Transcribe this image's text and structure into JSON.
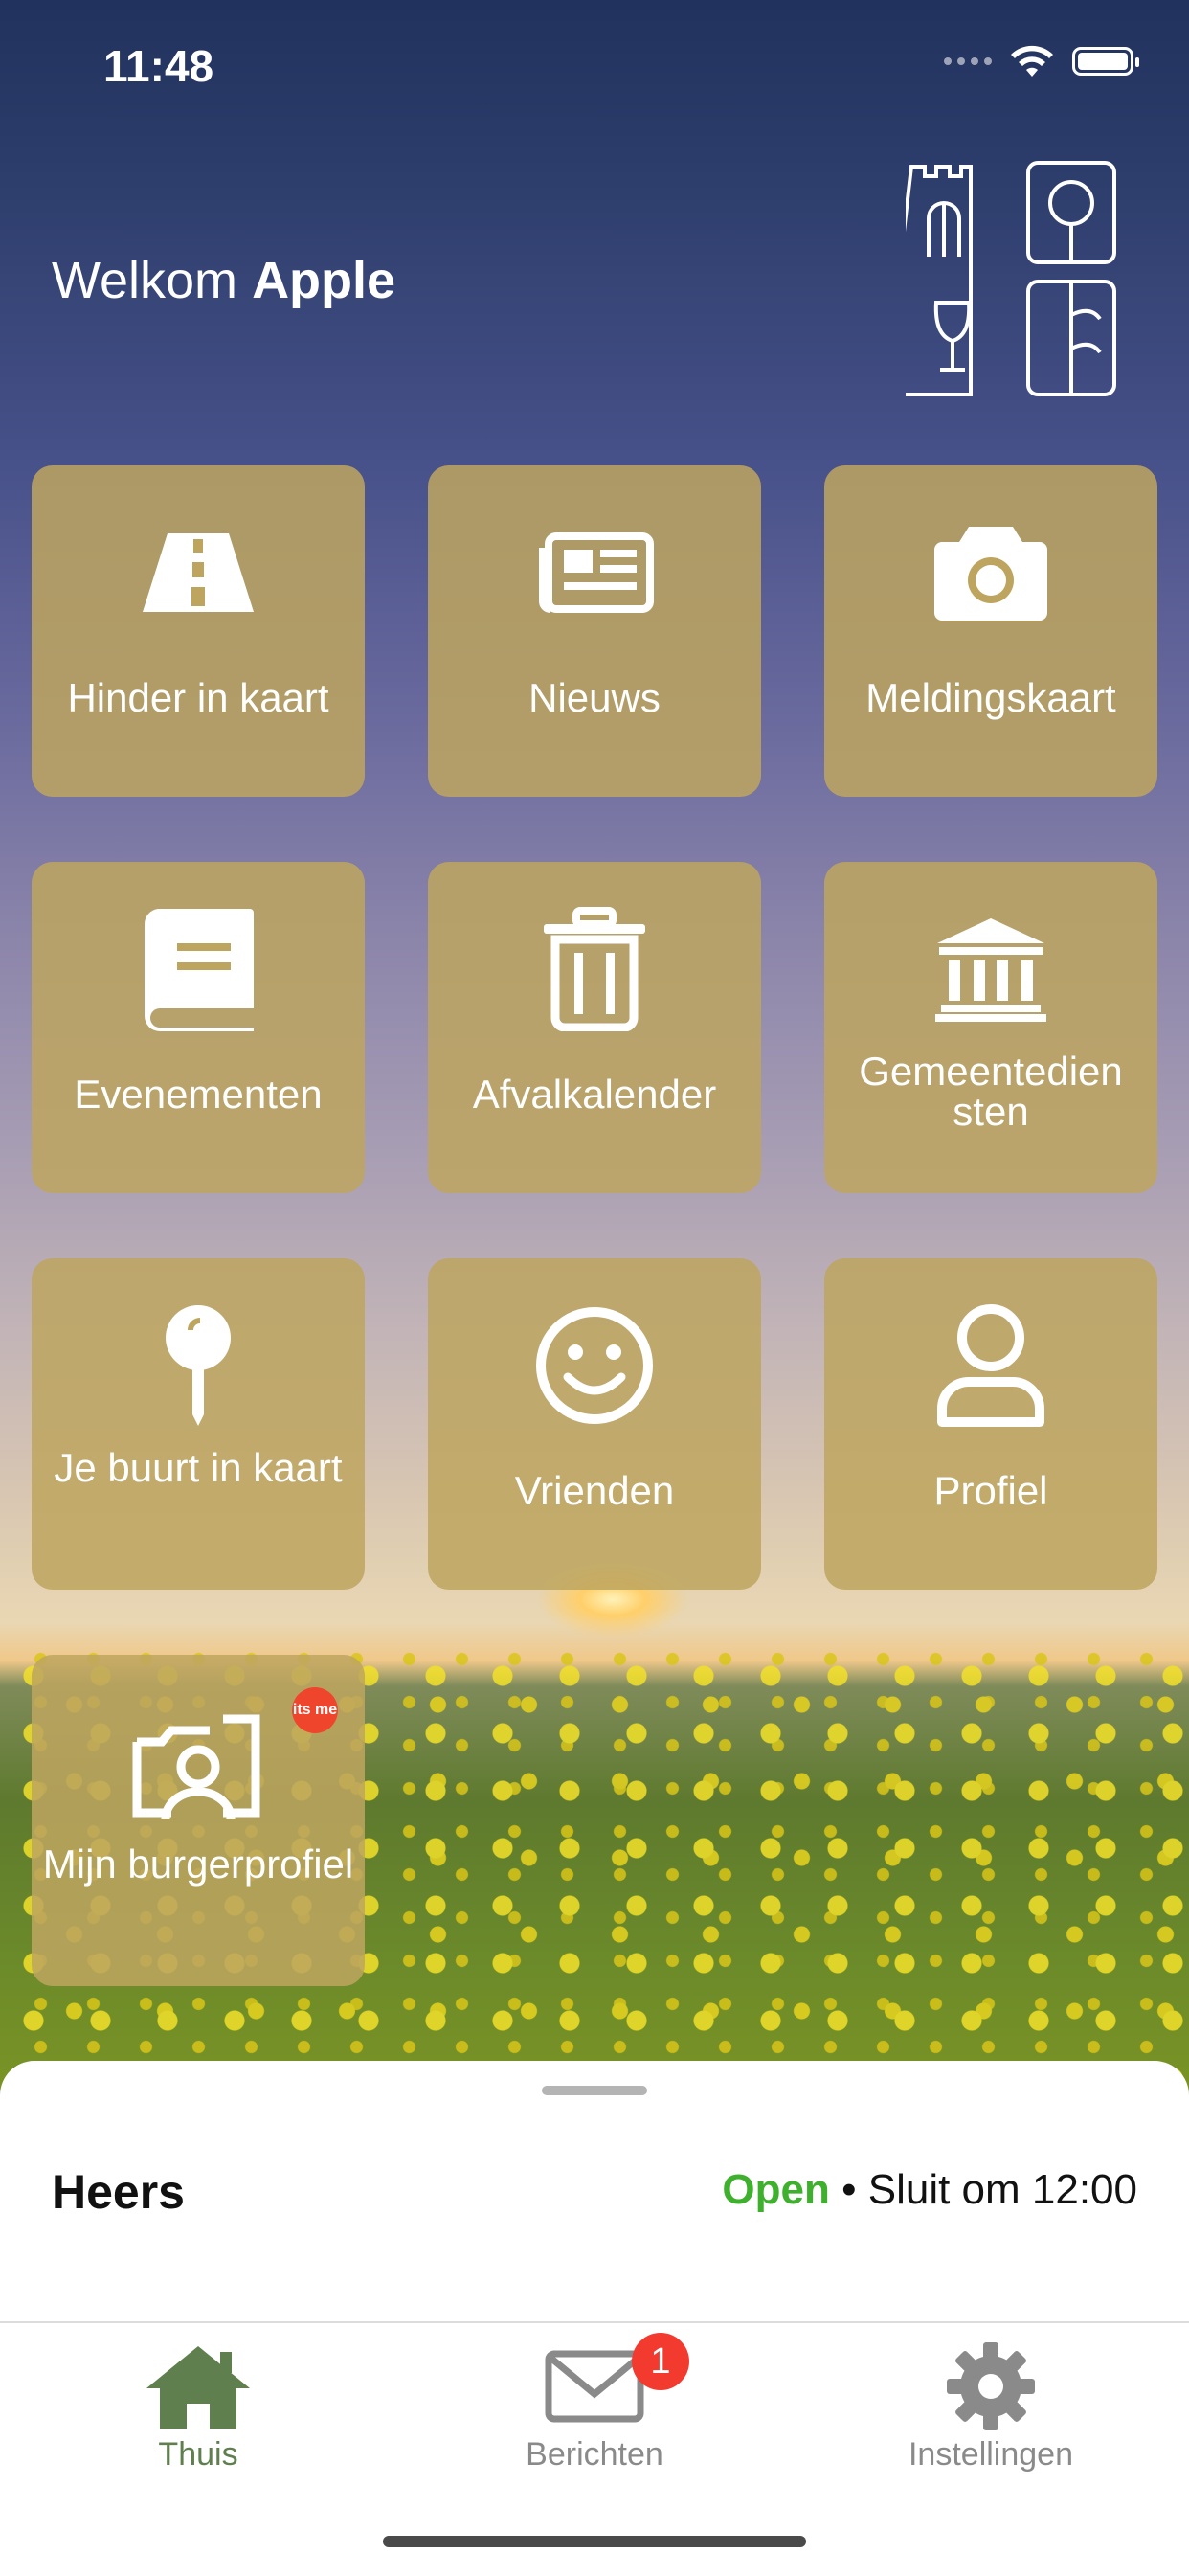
{
  "status_bar": {
    "time": "11:48"
  },
  "header": {
    "welcome_prefix": "Welkom",
    "user_name": "Apple"
  },
  "tiles": [
    {
      "label": "Hinder in kaart",
      "icon": "road-icon"
    },
    {
      "label": "Nieuws",
      "icon": "newspaper-icon"
    },
    {
      "label": "Meldingskaart",
      "icon": "camera-icon"
    },
    {
      "label": "Evenementen",
      "icon": "book-icon"
    },
    {
      "label": "Afvalkalender",
      "icon": "trash-icon"
    },
    {
      "label": "Gemeentedien sten",
      "icon": "town-hall-icon"
    },
    {
      "label": "Je buurt in kaart",
      "icon": "map-pin-icon"
    },
    {
      "label": "Vrienden",
      "icon": "smiley-icon"
    },
    {
      "label": "Profiel",
      "icon": "user-icon"
    },
    {
      "label": "Mijn burgerprofiel",
      "icon": "id-card-icon",
      "badge": "its me"
    }
  ],
  "location_card": {
    "name": "Heers",
    "status": "Open",
    "separator": "•",
    "closing_text": "Sluit om 12:00"
  },
  "tab_bar": {
    "tabs": [
      {
        "label": "Thuis",
        "icon": "home-icon",
        "active": true
      },
      {
        "label": "Berichten",
        "icon": "mail-icon",
        "badge": "1"
      },
      {
        "label": "Instellingen",
        "icon": "gear-icon"
      }
    ]
  },
  "colors": {
    "tile": "#bea55f",
    "active_tab": "#5f7f4e",
    "inactive_tab": "#8a8a8a",
    "open_status": "#3fb02d",
    "badge": "#f23a2f"
  }
}
